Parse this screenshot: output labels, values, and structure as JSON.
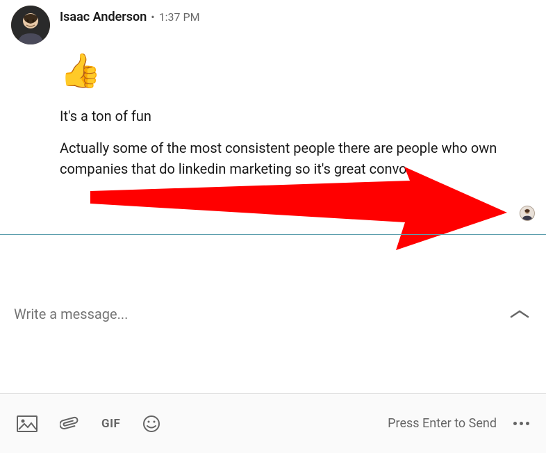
{
  "message": {
    "sender": "Isaac Anderson",
    "timestamp": "1:37 PM",
    "emoji": "👍",
    "line1": "It's a ton of fun",
    "line2": "Actually some of the most consistent people there are people who own companies that do linkedin marketing so it's great convo"
  },
  "compose": {
    "placeholder": "Write a message...",
    "send_hint": "Press Enter to Send"
  },
  "toolbar": {
    "gif_label": "GIF"
  },
  "annotation": {
    "arrow_color": "#ff0000"
  }
}
